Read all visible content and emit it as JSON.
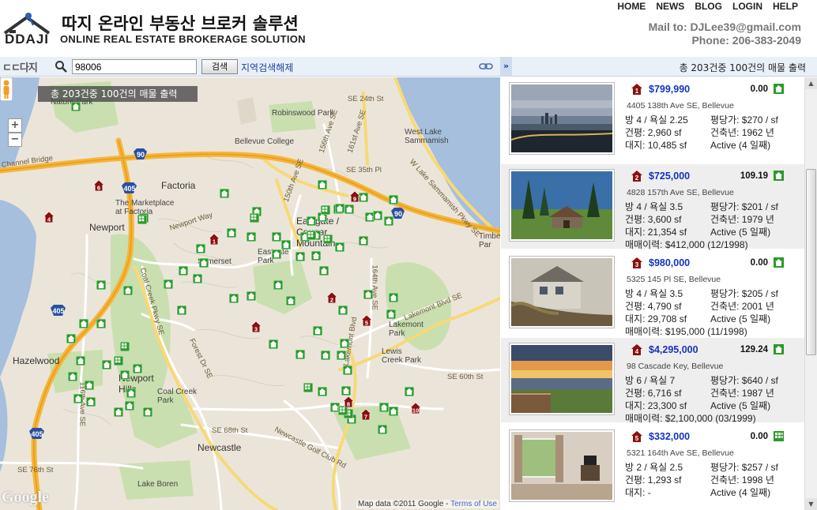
{
  "header": {
    "logo_text": "DDAJI",
    "brand_ko": "따지 온라인 부동산 브로커 솔루션",
    "brand_en": "ONLINE REAL ESTATE BROKERAGE SOLUTION",
    "nav": [
      "HOME",
      "NEWS",
      "BLOG",
      "LOGIN",
      "HELP"
    ],
    "mail": "Mail to: DJLee39@gmail.com",
    "phone": "Phone: 206-383-2049"
  },
  "search": {
    "logo": "ㄷㄷ다지",
    "zip_value": "98006",
    "search_button": "검색",
    "clear_link": "지역검색해제",
    "toggle": "»"
  },
  "results_text": "총 203건중 100건의 매물 출력",
  "map": {
    "overlay_text": "총 203건중 100건의 매물 출력",
    "zoom_in": "+",
    "zoom_out": "−",
    "attribution": "Map data ©2011 Google - ",
    "terms": "Terms of Use",
    "google": "Google",
    "places": [
      "Nature Park",
      "Robinswood Park",
      "Bellevue College",
      "West Lake Sammamish",
      "Factoria",
      "The Marketplace at Factoria",
      "Newport",
      "Somerset",
      "Eastgate Park",
      "Eastgate / Cougar Mountain",
      "Lakemont Park",
      "Lewis Creek Park",
      "Hazelwood",
      "Newport Hills",
      "Coal Creek Park",
      "Newcastle",
      "Lake Boren",
      "Timbe Par"
    ],
    "roads": [
      "SE 24th St",
      "SE 35th Pl",
      "W Lake Sammamish Pkwy SE",
      "Coal Creek Pkwy SE",
      "Forest Dr SE",
      "Lakemont Blvd SE",
      "SE 60th St",
      "SE 68th St",
      "Newcastle Golf Club Rd",
      "SE 76th St",
      "164th Ave SE",
      "150th Ave SE",
      "161st Ave SE",
      "156th Ave SE",
      "116th Ave SE",
      "Newport Way",
      "Channel Bridge",
      "Lakemont Blvd"
    ],
    "highways": [
      "90",
      "405",
      "90",
      "405",
      "405"
    ]
  },
  "listings": [
    {
      "num": "1",
      "price": "$799,990",
      "score": "0.00",
      "address": "4405 138th Ave SE, Bellevue",
      "rooms": "방 4 / 욕실 2.25",
      "price_per": "평당가: $270 / sf",
      "building": "건평: 2,960 sf",
      "year": "건축년: 1962 년",
      "lot": "대지: 10,485 sf",
      "status": "Active (4 일째)",
      "extra": "",
      "bg": "#ffffff",
      "type_icon": "house-icon"
    },
    {
      "num": "2",
      "price": "$725,000",
      "score": "109.19",
      "address": "4828 157th Ave SE, Bellevue",
      "rooms": "방 4 / 욕실 3.5",
      "price_per": "평당가: $201 / sf",
      "building": "건평: 3,600 sf",
      "year": "건축년: 1979 년",
      "lot": "대지: 21,354 sf",
      "status": "Active (5 일째)",
      "extra": "매매이력: $412,000 (12/1998)",
      "bg": "#eeeeee",
      "type_icon": "house-icon"
    },
    {
      "num": "3",
      "price": "$980,000",
      "score": "0.00",
      "address": "5325 145 Pl SE, Bellevue",
      "rooms": "방 4 / 욕실 3.5",
      "price_per": "평당가: $205 / sf",
      "building": "건평: 4,790 sf",
      "year": "건축년: 2001 년",
      "lot": "대지: 29,708 sf",
      "status": "Active (5 일째)",
      "extra": "매매이력: $195,000 (11/1998)",
      "bg": "#ffffff",
      "type_icon": "house-icon"
    },
    {
      "num": "4",
      "price": "$4,295,000",
      "score": "129.24",
      "address": "98 Cascade Key, Bellevue",
      "rooms": "방 6 / 욕실 7",
      "price_per": "평당가: $640 / sf",
      "building": "건평: 6,716 sf",
      "year": "건축년: 1987 년",
      "lot": "대지: 23,300 sf",
      "status": "Active (5 일째)",
      "extra": "매매이력: $2,100,000 (03/1999)",
      "bg": "#eeeeee",
      "type_icon": "house-icon"
    },
    {
      "num": "5",
      "price": "$332,000",
      "score": "0.00",
      "address": "5321 164th Ave SE, Bellevue",
      "rooms": "방 2 / 욕실 2.5",
      "price_per": "평당가: $257 / sf",
      "building": "건평: 1,293 sf",
      "year": "건축년: 1998 년",
      "lot": "대지: -",
      "status": "Active (4 일째)",
      "extra": "",
      "bg": "#ffffff",
      "type_icon": "condo-icon"
    }
  ],
  "colors": {
    "accent": "#1533c0",
    "marker_house": "#2a9a2a",
    "marker_featured": "#8b1010",
    "freeway": "#f7c84b",
    "water": "#a5bfdd",
    "park": "#c9dfaf"
  }
}
